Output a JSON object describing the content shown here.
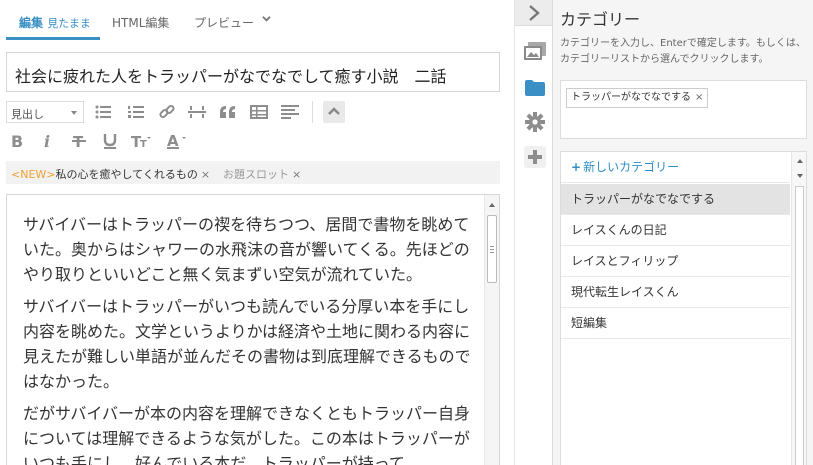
{
  "editor": {
    "tabs": {
      "edit_label": "編集",
      "edit_mode": "見たまま",
      "html_label": "HTML編集",
      "preview_label": "プレビュー"
    },
    "title": "社会に疲れた人をトラッパーがなでなでして癒す小説　二話",
    "toolbar": {
      "heading_select": "見出し",
      "buttons": [
        "unordered-list-icon",
        "ordered-list-icon",
        "link-icon",
        "horizontal-rule-icon",
        "quote-icon",
        "table-icon",
        "text-align-icon",
        "bold-icon",
        "italic-icon",
        "strikethrough-icon",
        "underline-icon",
        "font-size-icon",
        "font-color-icon",
        "collapse-up-icon"
      ]
    },
    "tags": [
      {
        "prefix": "<NEW>",
        "label": "私の心を癒やしてくれるもの",
        "close": "×"
      },
      {
        "prefix": "",
        "label": "お題スロット",
        "close": "×"
      }
    ],
    "paragraphs": [
      "サバイバーはトラッパーの禊を待ちつつ、居間で書物を眺めていた。奥からはシャワーの水飛沫の音が響いてくる。先ほどのやり取りといいどこと無く気まずい空気が流れていた。",
      "サバイバーはトラッパーがいつも読んでいる分厚い本を手にし内容を眺めた。文学というよりかは経済や土地に関わる内容に見えたが難しい単語が並んだその書物は到底理解できるものではなかった。",
      "だがサバイバーが本の内容を理解できなくともトラッパー自身については理解できるような気がした。この本はトラッパーがいつも手にし、好んでいる本だ。トラッパーが持って"
    ]
  },
  "category": {
    "title": "カテゴリー",
    "description": "カテゴリーを入力し、Enterで確定します。もしくは、カテゴリーリストから選んでクリックします。",
    "selected_chip": "トラッパーがなでなでする",
    "chip_close": "×",
    "new_category_label": "新しいカテゴリー",
    "new_category_icon": "+",
    "items": [
      "トラッパーがなでなでする",
      "レイスくんの日記",
      "レイスとフィリップ",
      "現代転生レイスくん",
      "短編集"
    ]
  },
  "colors": {
    "accent": "#3a8fc4",
    "new_tag": "#f0a030",
    "link": "#2f8fc6"
  }
}
